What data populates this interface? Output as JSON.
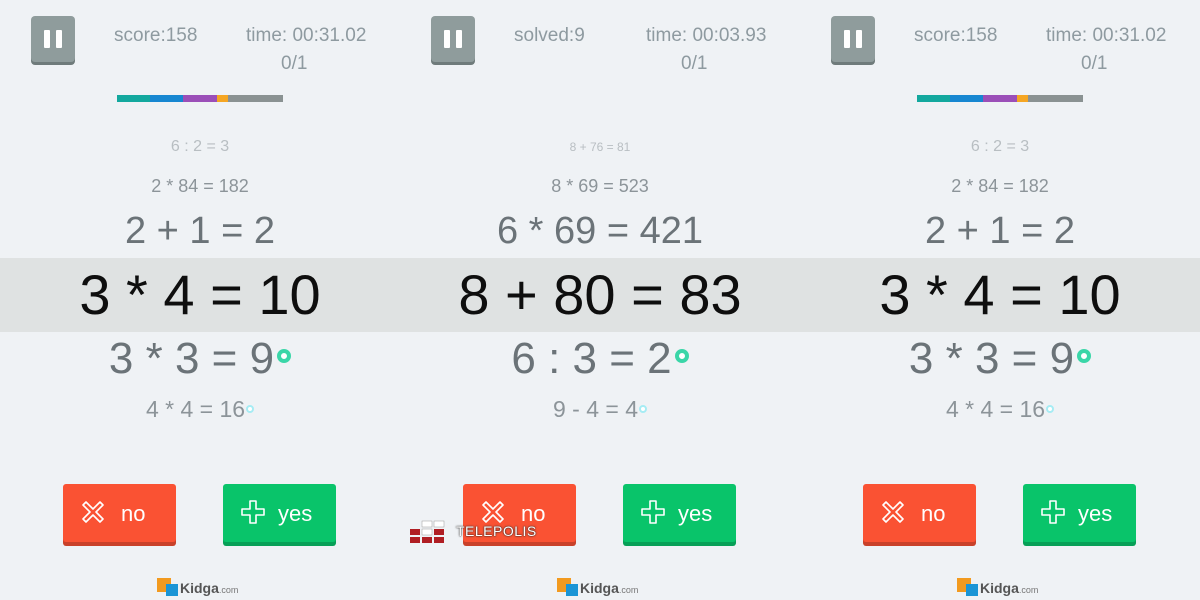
{
  "panels": [
    {
      "stat_left": "score:158",
      "time": "time: 00:31.02",
      "count": "0/1",
      "progress": [
        {
          "color": "#13a89e",
          "fraction": 0.2
        },
        {
          "color": "#1787d1",
          "fraction": 0.2
        },
        {
          "color": "#9b4fb8",
          "fraction": 0.2
        },
        {
          "color": "#f5a623",
          "fraction": 0.07
        },
        {
          "color": "#8a9292",
          "fraction": 0.33
        }
      ],
      "eq1": "6 : 2 = 3",
      "eq2": "2 * 84 = 182",
      "eq3": "2 + 1 = 2",
      "eq4": "3 * 4 = 10",
      "eq5": "3 * 3 = 9",
      "eq6": "4 * 4 = 16",
      "no_label": "no",
      "yes_label": "yes",
      "logo_text": "Kidga",
      "logo_domain": ".com"
    },
    {
      "stat_left": "solved:9",
      "time": "time: 00:03.93",
      "count": "0/1",
      "progress": [],
      "eq1": "8 + 76 = 81",
      "eq2": "8 * 69 = 523",
      "eq3": "6 * 69 = 421",
      "eq4": "8 + 80 = 83",
      "eq5": "6 : 3 = 2",
      "eq6": "9 - 4 = 4",
      "no_label": "no",
      "yes_label": "yes",
      "logo_text": "Kidga",
      "logo_domain": ".com"
    },
    {
      "stat_left": "score:158",
      "time": "time: 00:31.02",
      "count": "0/1",
      "progress": [
        {
          "color": "#13a89e",
          "fraction": 0.2
        },
        {
          "color": "#1787d1",
          "fraction": 0.2
        },
        {
          "color": "#9b4fb8",
          "fraction": 0.2
        },
        {
          "color": "#f5a623",
          "fraction": 0.07
        },
        {
          "color": "#8a9292",
          "fraction": 0.33
        }
      ],
      "eq1": "6 : 2 = 3",
      "eq2": "2 * 84 = 182",
      "eq3": "2 + 1 = 2",
      "eq4": "3 * 4 = 10",
      "eq5": "3 * 3 = 9",
      "eq6": "4 * 4 = 16",
      "no_label": "no",
      "yes_label": "yes",
      "logo_text": "Kidga",
      "logo_domain": ".com"
    }
  ],
  "watermark": "TELEPOLIS",
  "colors": {
    "no_button": "#fa5233",
    "yes_button": "#09c46a",
    "correct_dot": "#3ad6a8",
    "highlight_band": "#dfe2e2"
  },
  "icons": {
    "pause": "pause-icon",
    "no": "x-outline-icon",
    "yes": "plus-outline-icon"
  }
}
